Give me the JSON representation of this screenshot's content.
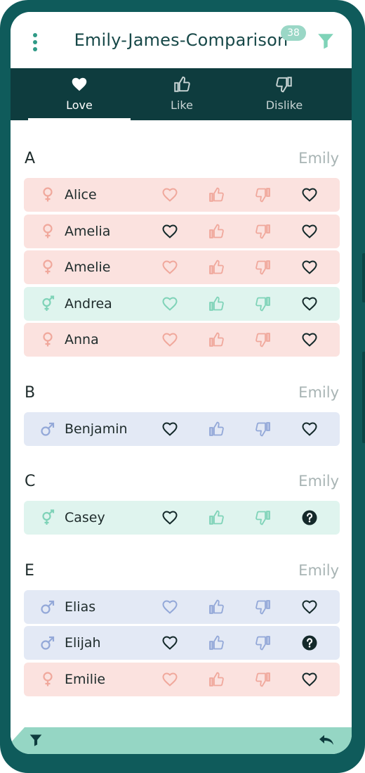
{
  "app": {
    "title": "Emily-James-Comparison",
    "badge_count": "38"
  },
  "tabs": [
    {
      "label": "Love",
      "icon": "heart-icon",
      "active": true
    },
    {
      "label": "Like",
      "icon": "thumbs-up-icon",
      "active": false
    },
    {
      "label": "Dislike",
      "icon": "thumbs-down-icon",
      "active": false
    }
  ],
  "colors": {
    "female": "#f0a89c",
    "neutral": "#7fd3b8",
    "male": "#93a8d8",
    "female_bg": "#fbe2df",
    "neutral_bg": "#dff4ee",
    "male_bg": "#e3e9f5",
    "header_dark": "#0e3c3e",
    "accent": "#95d6c4"
  },
  "sections": [
    {
      "letter": "A",
      "user": "Emily",
      "rows": [
        {
          "name": "Alice",
          "gender": "female",
          "selected": "none",
          "partner": "heart"
        },
        {
          "name": "Amelia",
          "gender": "female",
          "selected": "love",
          "partner": "heart"
        },
        {
          "name": "Amelie",
          "gender": "female",
          "selected": "none",
          "partner": "heart"
        },
        {
          "name": "Andrea",
          "gender": "neutral",
          "selected": "none",
          "partner": "heart"
        },
        {
          "name": "Anna",
          "gender": "female",
          "selected": "none",
          "partner": "heart"
        }
      ]
    },
    {
      "letter": "B",
      "user": "Emily",
      "rows": [
        {
          "name": "Benjamin",
          "gender": "male",
          "selected": "love",
          "partner": "heart"
        }
      ]
    },
    {
      "letter": "C",
      "user": "Emily",
      "rows": [
        {
          "name": "Casey",
          "gender": "neutral",
          "selected": "love",
          "partner": "question"
        }
      ]
    },
    {
      "letter": "E",
      "user": "Emily",
      "rows": [
        {
          "name": "Elias",
          "gender": "male",
          "selected": "none",
          "partner": "heart"
        },
        {
          "name": "Elijah",
          "gender": "male",
          "selected": "love",
          "partner": "question"
        },
        {
          "name": "Emilie",
          "gender": "female",
          "selected": "none",
          "partner": "heart"
        }
      ]
    }
  ],
  "bottom_bar": {
    "left_icon": "filter-icon",
    "right_icon": "back-arrow-icon"
  }
}
